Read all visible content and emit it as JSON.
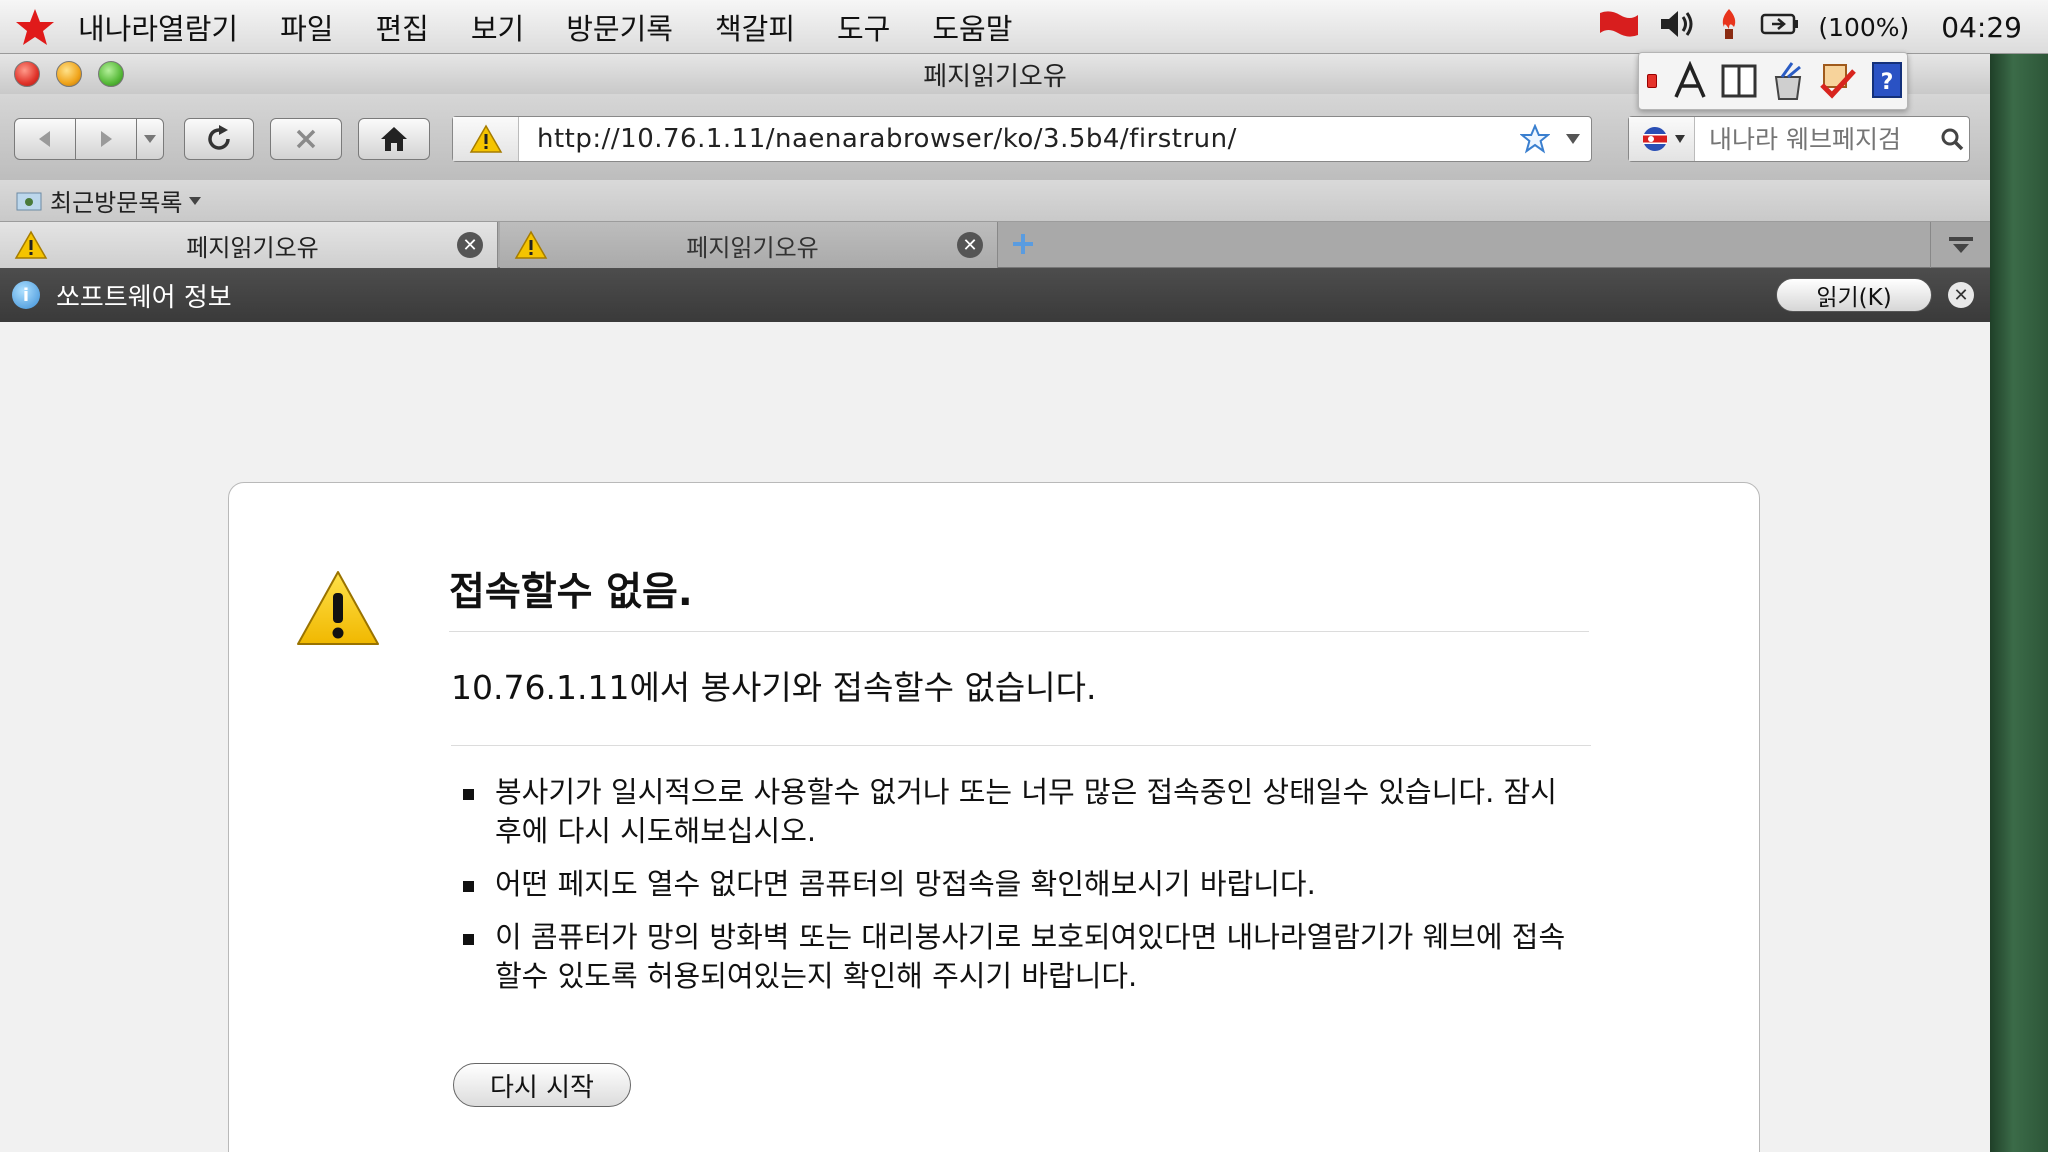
{
  "menubar": {
    "app_name": "내나라열람기",
    "items": [
      "파일",
      "편집",
      "보기",
      "방문기록",
      "책갈피",
      "도구",
      "도움말"
    ],
    "battery": "(100%)",
    "clock": "04:29"
  },
  "window": {
    "title": "페지읽기오유"
  },
  "toolbar": {
    "url": "http://10.76.1.11/naenarabrowser/ko/3.5b4/firstrun/",
    "search_placeholder": "내나라 웨브페지검"
  },
  "bookmarks": {
    "recent_label": "최근방문목록"
  },
  "tabs": [
    {
      "label": "페지읽기오유",
      "active": true
    },
    {
      "label": "페지읽기오유",
      "active": false
    }
  ],
  "notification": {
    "message": "쏘프트웨어 정보",
    "read_button": "읽기(K)"
  },
  "error": {
    "title": "접속할수 없음.",
    "subtitle": "10.76.1.11에서 봉사기와 접속할수 없습니다.",
    "items": [
      "봉사기가 일시적으로 사용할수 없거나 또는 너무 많은 접속중인 상태일수 있습니다. 잠시후에 다시 시도해보십시오.",
      "어떤 페지도 열수 없다면 콤퓨터의 망접속을 확인해보시기 바랍니다.",
      "이 콤퓨터가 망의 방화벽 또는 대리봉사기로 보호되여있다면 내나라열람기가 웨브에 접속할수 있도록 허용되여있는지 확인해 주시기 바랍니다."
    ],
    "retry_label": "다시 시작"
  },
  "colors": {
    "warning": "#f5c400",
    "notification_bar": "#444444",
    "flag_red": "#d81e1e"
  },
  "icons": [
    "red-star-icon",
    "flag-icon",
    "volume-icon",
    "torch-icon",
    "battery-icon",
    "warning-icon",
    "info-icon",
    "bookmark-star-icon",
    "search-icon"
  ]
}
